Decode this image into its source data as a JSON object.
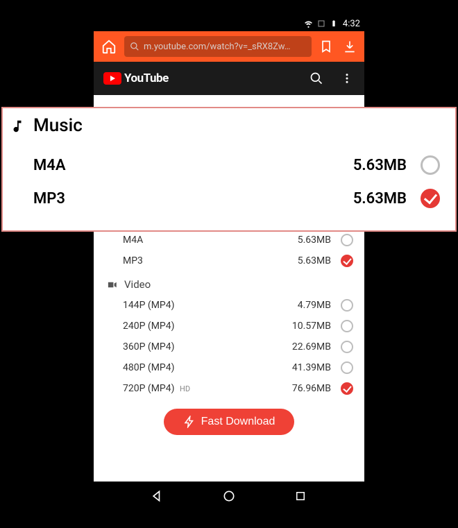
{
  "status": {
    "time": "4:32"
  },
  "toolbar": {
    "url": "m.youtube.com/watch?v=_sRX8Zw…"
  },
  "youtube": {
    "brand": "YouTube"
  },
  "sections": {
    "music": {
      "title": "Music",
      "items": [
        {
          "format": "M4A",
          "size": "5.63MB",
          "selected": false
        },
        {
          "format": "MP3",
          "size": "5.63MB",
          "selected": true
        }
      ]
    },
    "video": {
      "title": "Video",
      "items": [
        {
          "format": "144P  (MP4)",
          "size": "4.79MB",
          "badge": "",
          "selected": false
        },
        {
          "format": "240P  (MP4)",
          "size": "10.57MB",
          "badge": "",
          "selected": false
        },
        {
          "format": "360P  (MP4)",
          "size": "22.69MB",
          "badge": "",
          "selected": false
        },
        {
          "format": "480P  (MP4)",
          "size": "41.39MB",
          "badge": "",
          "selected": false
        },
        {
          "format": "720P  (MP4)",
          "size": "76.96MB",
          "badge": "HD",
          "selected": true
        }
      ]
    }
  },
  "cta": {
    "fast_download": "Fast Download"
  },
  "overlay": {
    "title": "Music",
    "items": [
      {
        "format": "M4A",
        "size": "5.63MB",
        "selected": false
      },
      {
        "format": "MP3",
        "size": "5.63MB",
        "selected": true
      }
    ]
  }
}
